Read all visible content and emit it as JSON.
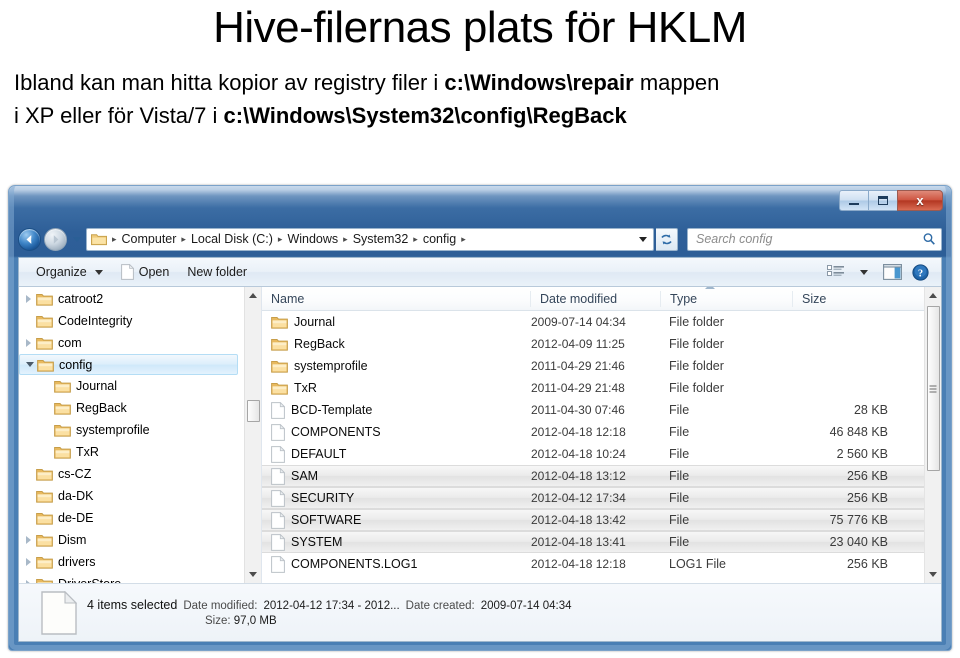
{
  "slide": {
    "title": "Hive-filernas plats för HKLM",
    "body": {
      "line1_a": "Ibland kan man hitta kopior av registry filer i ",
      "line1_b": "c:\\Windows\\repair",
      "line1_c": " mappen",
      "line2_a": "i XP eller för Vista/7 i ",
      "line2_b": "c:\\Windows\\System32\\config\\RegBack"
    }
  },
  "explorer": {
    "caption": {
      "minimize_label": "Minimize",
      "maximize_label": "Maximize",
      "close_label": "x"
    },
    "address": {
      "breadcrumbs": [
        "Computer",
        "Local Disk (C:)",
        "Windows",
        "System32",
        "config"
      ],
      "separator": "▸",
      "back_label": "Back",
      "forward_label": "Forward",
      "history_label": "Recent pages",
      "refresh_label": "Refresh"
    },
    "search": {
      "placeholder": "Search config",
      "value": "Search config"
    },
    "toolbar": {
      "organize": "Organize",
      "open": "Open",
      "new_folder": "New folder",
      "view_label": "Change your view",
      "preview_label": "Show the preview pane",
      "help_label": "Get help"
    },
    "tree": [
      {
        "label": "catroot2",
        "indent": 1,
        "twisty": "closed",
        "selected": false
      },
      {
        "label": "CodeIntegrity",
        "indent": 1,
        "twisty": "none",
        "selected": false
      },
      {
        "label": "com",
        "indent": 1,
        "twisty": "closed",
        "selected": false
      },
      {
        "label": "config",
        "indent": 1,
        "twisty": "open",
        "selected": true
      },
      {
        "label": "Journal",
        "indent": 2,
        "twisty": "none",
        "selected": false
      },
      {
        "label": "RegBack",
        "indent": 2,
        "twisty": "none",
        "selected": false
      },
      {
        "label": "systemprofile",
        "indent": 2,
        "twisty": "none",
        "selected": false
      },
      {
        "label": "TxR",
        "indent": 2,
        "twisty": "none",
        "selected": false
      },
      {
        "label": "cs-CZ",
        "indent": 1,
        "twisty": "none",
        "selected": false
      },
      {
        "label": "da-DK",
        "indent": 1,
        "twisty": "none",
        "selected": false
      },
      {
        "label": "de-DE",
        "indent": 1,
        "twisty": "none",
        "selected": false
      },
      {
        "label": "Dism",
        "indent": 1,
        "twisty": "closed",
        "selected": false
      },
      {
        "label": "drivers",
        "indent": 1,
        "twisty": "closed",
        "selected": false
      },
      {
        "label": "DriverStore",
        "indent": 1,
        "twisty": "closed",
        "selected": false
      }
    ],
    "columns": [
      {
        "key": "name",
        "label": "Name"
      },
      {
        "key": "date",
        "label": "Date modified"
      },
      {
        "key": "type",
        "label": "Type"
      },
      {
        "key": "size",
        "label": "Size"
      }
    ],
    "sorted_column": "Type",
    "files": [
      {
        "name": "Journal",
        "date": "2009-07-14 04:34",
        "type": "File folder",
        "size": "",
        "icon": "folder-icon",
        "selected": false
      },
      {
        "name": "RegBack",
        "date": "2012-04-09 11:25",
        "type": "File folder",
        "size": "",
        "icon": "folder-icon",
        "selected": false
      },
      {
        "name": "systemprofile",
        "date": "2011-04-29 21:46",
        "type": "File folder",
        "size": "",
        "icon": "folder-icon",
        "selected": false
      },
      {
        "name": "TxR",
        "date": "2011-04-29 21:48",
        "type": "File folder",
        "size": "",
        "icon": "folder-icon",
        "selected": false
      },
      {
        "name": "BCD-Template",
        "date": "2011-04-30 07:46",
        "type": "File",
        "size": "28 KB",
        "icon": "file-icon",
        "selected": false
      },
      {
        "name": "COMPONENTS",
        "date": "2012-04-18 12:18",
        "type": "File",
        "size": "46 848 KB",
        "icon": "file-icon",
        "selected": false
      },
      {
        "name": "DEFAULT",
        "date": "2012-04-18 10:24",
        "type": "File",
        "size": "2 560 KB",
        "icon": "file-icon",
        "selected": false
      },
      {
        "name": "SAM",
        "date": "2012-04-18 13:12",
        "type": "File",
        "size": "256 KB",
        "icon": "file-icon",
        "selected": true
      },
      {
        "name": "SECURITY",
        "date": "2012-04-12 17:34",
        "type": "File",
        "size": "256 KB",
        "icon": "file-icon",
        "selected": true
      },
      {
        "name": "SOFTWARE",
        "date": "2012-04-18 13:42",
        "type": "File",
        "size": "75 776 KB",
        "icon": "file-icon",
        "selected": true
      },
      {
        "name": "SYSTEM",
        "date": "2012-04-18 13:41",
        "type": "File",
        "size": "23 040 KB",
        "icon": "file-icon",
        "selected": true
      },
      {
        "name": "COMPONENTS.LOG1",
        "date": "2012-04-18 12:18",
        "type": "LOG1 File",
        "size": "256 KB",
        "icon": "file-icon",
        "selected": false
      }
    ],
    "status": {
      "selection": "4 items selected",
      "date_modified_label": "Date modified:",
      "date_modified_value": "2012-04-12 17:34 - 2012...",
      "date_created_label": "Date created:",
      "date_created_value": "2009-07-14 04:34",
      "size_label": "Size:",
      "size_value": "97,0 MB"
    }
  },
  "colors": {
    "frame_blue": "#2d5e97",
    "close_red": "#c0442c",
    "selection_blue": "#cfe8fa",
    "folder_yellow": "#f6d58a",
    "accent": "#1d5a9c"
  }
}
